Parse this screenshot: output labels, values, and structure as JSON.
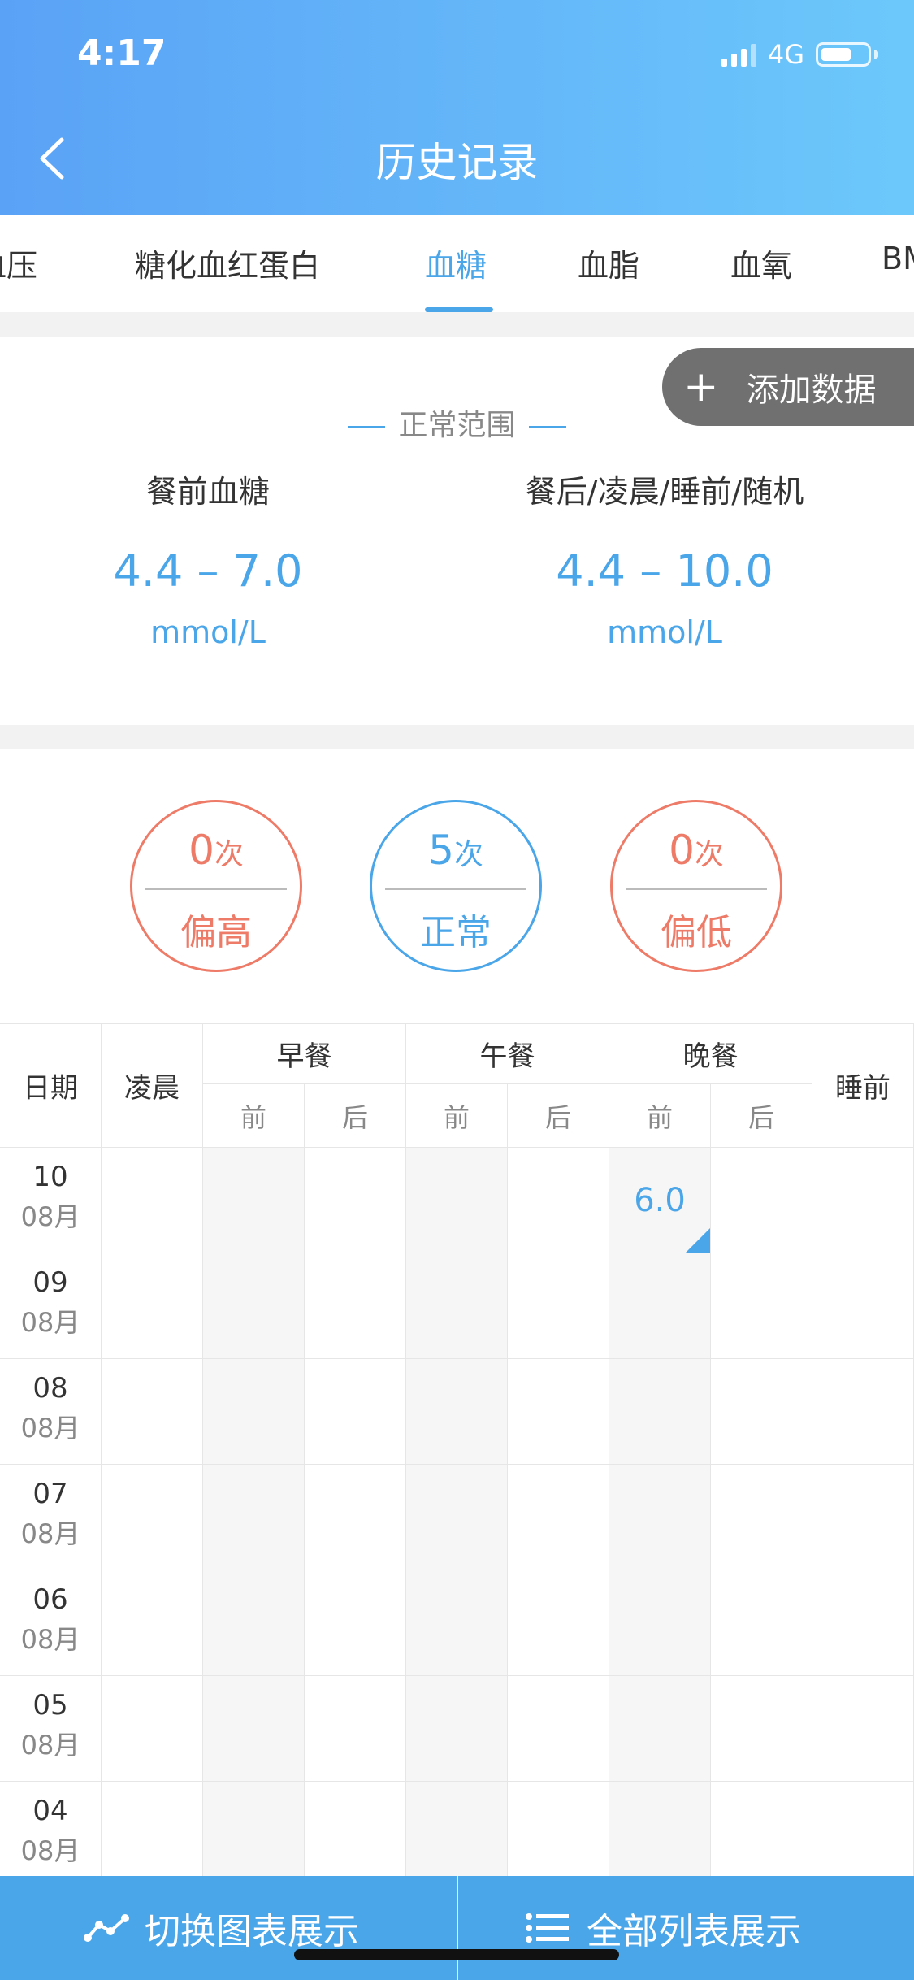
{
  "status": {
    "time": "4:17",
    "network": "4G",
    "battery_level": 0.65
  },
  "header": {
    "title": "历史记录",
    "back_icon": "chevron-left-icon"
  },
  "tabs": [
    {
      "label": "血压"
    },
    {
      "label": "糖化血红蛋白"
    },
    {
      "label": "血糖",
      "active": true
    },
    {
      "label": "血脂"
    },
    {
      "label": "血氧"
    },
    {
      "label": "BMI"
    }
  ],
  "range": {
    "add_button": "添加数据",
    "title": "正常范围",
    "pre_meal": {
      "label": "餐前血糖",
      "value": "4.4 – 7.0",
      "unit": "mmol/L"
    },
    "post_meal": {
      "label": "餐后/凌晨/睡前/随机",
      "value": "4.4 – 10.0",
      "unit": "mmol/L"
    }
  },
  "counts": {
    "unit": "次",
    "high": {
      "count": "0",
      "label": "偏高",
      "color": "#ee7b68"
    },
    "normal": {
      "count": "5",
      "label": "正常",
      "color": "#4aa6e8"
    },
    "low": {
      "count": "0",
      "label": "偏低",
      "color": "#ee7b68"
    }
  },
  "table": {
    "headers": {
      "date": "日期",
      "early_morning": "凌晨",
      "breakfast": "早餐",
      "lunch": "午餐",
      "dinner": "晚餐",
      "bedtime": "睡前",
      "before": "前",
      "after": "后"
    },
    "rows": [
      {
        "day": "10",
        "month": "08月",
        "dinner_before": "6.0"
      },
      {
        "day": "09",
        "month": "08月"
      },
      {
        "day": "08",
        "month": "08月"
      },
      {
        "day": "07",
        "month": "08月"
      },
      {
        "day": "06",
        "month": "08月"
      },
      {
        "day": "05",
        "month": "08月"
      },
      {
        "day": "04",
        "month": "08月"
      }
    ]
  },
  "bottom": {
    "chart_view": "切换图表展示",
    "list_view": "全部列表展示"
  }
}
